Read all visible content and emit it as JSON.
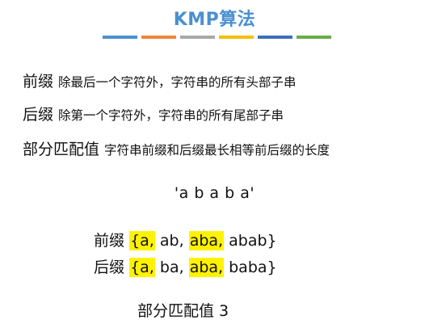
{
  "title": "KMP算法",
  "accent_colors": [
    "#4a90d0",
    "#f2843a",
    "#a8a8a8",
    "#f5c000",
    "#3d6ebd",
    "#6aab4c"
  ],
  "highlight_color": "#fff200",
  "definitions": [
    {
      "term": "前缀",
      "desc": "除最后一个字符外，字符串的所有头部子串"
    },
    {
      "term": "后缀",
      "desc": "除第一个字符外，字符串的所有尾部子串"
    },
    {
      "term": "部分匹配值",
      "desc": "字符串前缀和后缀最长相等前后缀的长度"
    }
  ],
  "example": "'a b a b a'",
  "prefix": {
    "label": "前缀",
    "open": "{",
    "items": [
      "a,",
      "ab,",
      "aba,",
      "abab}"
    ],
    "sep": " "
  },
  "suffix": {
    "label": "后缀",
    "open": "{",
    "items": [
      "a,",
      "ba,",
      "aba,",
      "baba}"
    ],
    "sep": " "
  },
  "result": "部分匹配值 3"
}
